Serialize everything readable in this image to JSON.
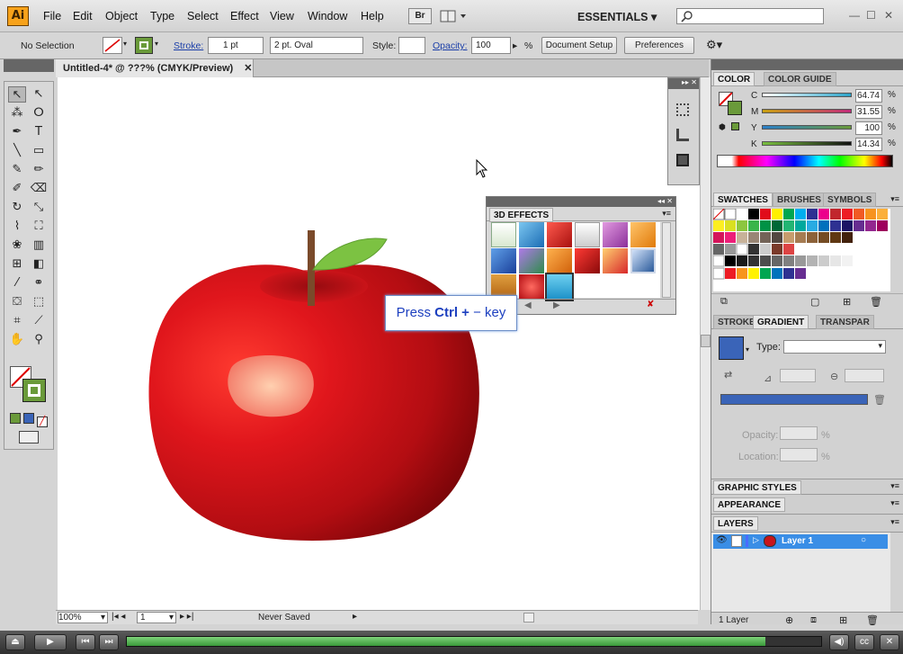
{
  "app": {
    "logo": "Ai",
    "essentials": "ESSENTIALS ▾",
    "bridge": "Br"
  },
  "menu": [
    "File",
    "Edit",
    "Object",
    "Type",
    "Select",
    "Effect",
    "View",
    "Window",
    "Help"
  ],
  "control": {
    "selection": "No Selection",
    "stroke_label": "Stroke:",
    "stroke_value": "1 pt",
    "brush": "2 pt. Oval",
    "style_label": "Style:",
    "opacity_label": "Opacity:",
    "opacity_value": "100",
    "opacity_unit": "%",
    "doc_setup": "Document Setup",
    "preferences": "Preferences"
  },
  "document": {
    "tab_title": "Untitled-4* @ ???% (CMYK/Preview)",
    "zoom": "100%",
    "artboard": "1",
    "save_state": "Never Saved"
  },
  "fx_panel": {
    "title": "3D EFFECTS"
  },
  "tooltip": {
    "prefix": "Press ",
    "key": "Ctrl +",
    "suffix": " − key"
  },
  "color_panel": {
    "tabs": [
      "COLOR",
      "COLOR GUIDE"
    ],
    "channels": [
      {
        "name": "C",
        "value": "64.74",
        "unit": "%",
        "color": "#2ba3c8"
      },
      {
        "name": "M",
        "value": "31.55",
        "unit": "%",
        "color": "#c02a7a"
      },
      {
        "name": "Y",
        "value": "100",
        "unit": "%",
        "color": "#e2d400"
      },
      {
        "name": "K",
        "value": "14.34",
        "unit": "%",
        "color": "#111111"
      }
    ]
  },
  "swatches_panel": {
    "tabs": [
      "SWATCHES",
      "BRUSHES",
      "SYMBOLS"
    ]
  },
  "gradient_panel": {
    "tabs": [
      "STROKE",
      "GRADIENT",
      "TRANSPAR"
    ],
    "type_label": "Type:",
    "opacity_label": "Opacity:",
    "location_label": "Location:",
    "unit": "%"
  },
  "graphic_styles": "GRAPHIC STYLES",
  "appearance": "APPEARANCE",
  "layers": {
    "title": "LAYERS",
    "layer_name": "Layer 1",
    "count": "1 Layer"
  },
  "colors": {
    "accent": "#3a64b8",
    "apple_red": "#c8151b",
    "leaf_green": "#7cc242",
    "stem": "#7a4a2a"
  }
}
